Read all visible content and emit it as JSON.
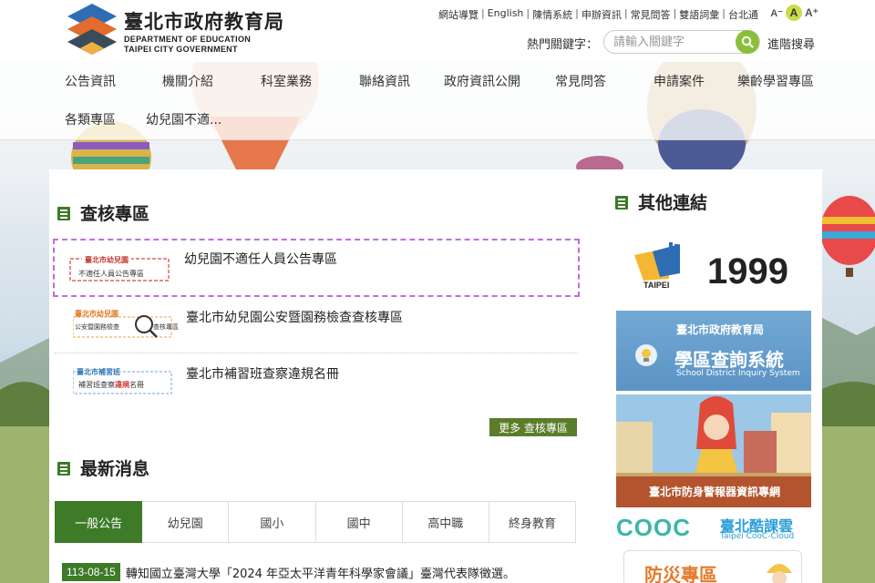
{
  "header": {
    "brand_zh": "臺北市政府教育局",
    "brand_en_1": "DEPARTMENT OF EDUCATION",
    "brand_en_2": "TAIPEI CITY GOVERNMENT",
    "top_links": [
      "網站導覽",
      "English",
      "陳情系統",
      "申辦資訊",
      "常見問答",
      "雙語詞彙",
      "台北通"
    ],
    "font_size": {
      "small": "A⁻",
      "mid": "A",
      "big": "A⁺"
    },
    "hot_keyword_label": "熱門關鍵字：",
    "search_placeholder": "請輸入關鍵字",
    "advanced_search": "進階搜尋",
    "logo_colors": [
      "#2e6db4",
      "#e36b2c",
      "#3a4b5c",
      "#f0b040"
    ]
  },
  "nav": {
    "items": [
      "公告資訊",
      "機關介紹",
      "科室業務",
      "聯絡資訊",
      "政府資訊公開",
      "常見問答",
      "申請案件",
      "樂齡學習專區",
      "各類專區",
      "幼兒園不適..."
    ]
  },
  "review": {
    "title": "查核專區",
    "items": [
      {
        "label": "幼兒園不適任人員公告專區",
        "badge_line1": "臺北市幼兒園",
        "badge_line2": "不適任人員公告專區"
      },
      {
        "label": "臺北市幼兒園公安暨園務檢查查核專區",
        "badge_line1": "臺北市幼兒園",
        "badge_line2": "公安暨園務檢查",
        "badge_line3": "查核專區"
      },
      {
        "label": "臺北市補習班查察違規名冊",
        "badge_line1": "臺北市補習班",
        "badge_line2": "補習班查察",
        "badge_line3": "違規",
        "badge_line4": "名冊"
      }
    ],
    "more_label": "更多 查核專區"
  },
  "news": {
    "title": "最新消息",
    "tabs": [
      "一般公告",
      "幼兒園",
      "國小",
      "國中",
      "高中職",
      "終身教育"
    ],
    "active_tab": "一般公告",
    "items": [
      {
        "date": "113-08-15",
        "text": "轉知國立臺灣大學「2024 年亞太平洋青年科學家會議」臺灣代表隊徵選。"
      }
    ]
  },
  "other_links": {
    "title": "其他連結",
    "hotline_number": "1999",
    "hotline_city": "TAIPEI",
    "district_org": "臺北市政府教育局",
    "district_title": "學區查詢系統",
    "district_en": "School District Inquiry System",
    "alarm_title": "臺北市防身警報器資訊專網",
    "cooc_letters": "COOC",
    "cooc_zh": "臺北酷課雲",
    "cooc_en": "Taipei CooC-Cloud",
    "disaster_title": "防災專區"
  },
  "colors": {
    "accent_green": "#3d7b28",
    "more_green": "#5a7d2a",
    "search_green": "#8bbf3a",
    "focus_purple": "#c46be0"
  }
}
